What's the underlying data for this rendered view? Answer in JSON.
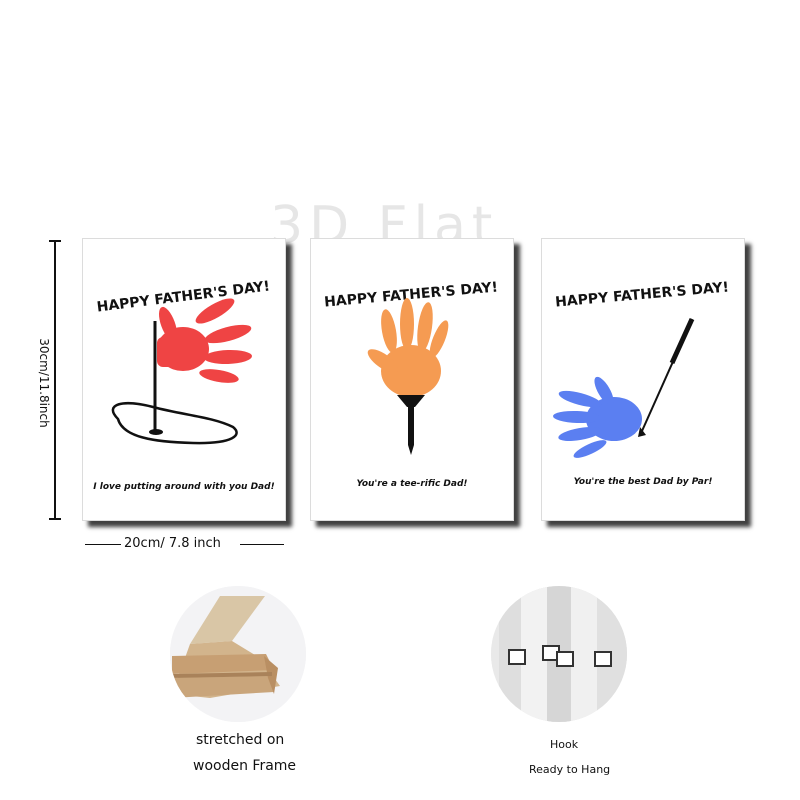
{
  "watermark": "3D Flat",
  "colors": {
    "red_hand": "#ef4444",
    "orange_hand": "#f59b52",
    "blue_hand": "#5b7ff1",
    "ink": "#111111"
  },
  "canvases": [
    {
      "heading": "HAPPY FATHER'S DAY!",
      "caption": "I love putting around with you Dad!",
      "illustration": "golf-flag-icon"
    },
    {
      "heading": "HAPPY FATHER'S DAY!",
      "caption": "You're a tee-rific Dad!",
      "illustration": "golf-tee-icon"
    },
    {
      "heading": "HAPPY FATHER'S DAY!",
      "caption": "You're the best Dad by Par!",
      "illustration": "golf-club-icon"
    }
  ],
  "dimensions": {
    "height_label": "30cm/11.8inch",
    "width_label": "20cm/ 7.8 inch"
  },
  "details": {
    "frame": {
      "line1": "stretched on",
      "line2": "wooden Frame"
    },
    "hook": {
      "line1": "Hook",
      "line2": "Ready to Hang"
    }
  }
}
